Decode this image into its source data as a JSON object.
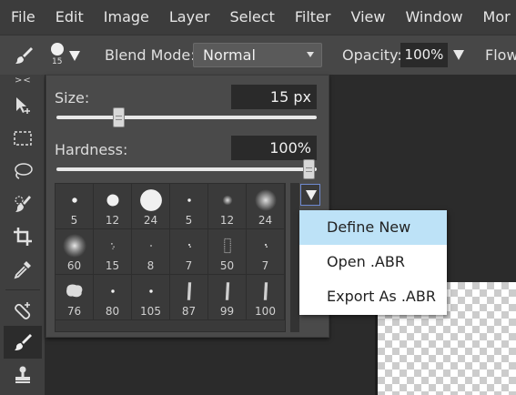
{
  "menubar": {
    "items": [
      "File",
      "Edit",
      "Image",
      "Layer",
      "Select",
      "Filter",
      "View",
      "Window",
      "Mor"
    ]
  },
  "options": {
    "brush_size_label": "15",
    "blend_mode_label": "Blend Mode:",
    "blend_mode_value": "Normal",
    "opacity_label": "Opacity:",
    "opacity_value": "100%",
    "flow_label": "Flow"
  },
  "toolbar": {
    "collapse_label": "><",
    "tools": [
      "move-tool",
      "marquee-tool",
      "lasso-tool",
      "quick-select-tool",
      "crop-tool",
      "eyedropper-tool",
      "healing-tool",
      "brush-tool",
      "stamp-tool"
    ],
    "active_tool": "brush-tool"
  },
  "brush_panel": {
    "size_label": "Size:",
    "size_value": "15  px",
    "size_level": 0.23,
    "hardness_label": "Hardness:",
    "hardness_value": "100%",
    "hardness_level": 1.0,
    "brushes": [
      {
        "size": "5",
        "shape": "dot-small"
      },
      {
        "size": "12",
        "shape": "dot-medium"
      },
      {
        "size": "24",
        "shape": "dot-large"
      },
      {
        "size": "5",
        "shape": "dot-tiny"
      },
      {
        "size": "12",
        "shape": "soft-small"
      },
      {
        "size": "24",
        "shape": "soft-medium"
      },
      {
        "size": "60",
        "shape": "soft-large"
      },
      {
        "size": "15",
        "shape": "speckle"
      },
      {
        "size": "8",
        "shape": "speckle-tiny"
      },
      {
        "size": "7",
        "shape": "speckle-small"
      },
      {
        "size": "50",
        "shape": "texture"
      },
      {
        "size": "7",
        "shape": "speckle-small"
      },
      {
        "size": "76",
        "shape": "blob"
      },
      {
        "size": "80",
        "shape": "dot-tiny"
      },
      {
        "size": "105",
        "shape": "dot-tiny"
      },
      {
        "size": "87",
        "shape": "stroke"
      },
      {
        "size": "99",
        "shape": "stroke"
      },
      {
        "size": "100",
        "shape": "stroke"
      }
    ]
  },
  "brush_menu": {
    "items": [
      "Define New",
      "Open .ABR",
      "Export As .ABR"
    ],
    "highlighted": "Define New"
  }
}
